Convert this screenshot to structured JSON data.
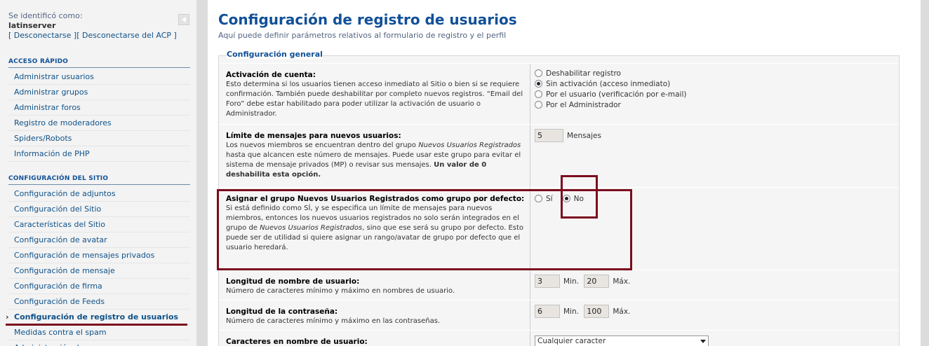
{
  "sidebar": {
    "identified_as": "Se identificó como:",
    "username": "latinserver",
    "links_prefix": "[ ",
    "logout": "Desconectarse",
    "links_mid": " ][ ",
    "logout_acp": "Desconectarse del ACP",
    "links_suffix": " ]",
    "quick_access": {
      "title": "ACCESO RÁPIDO",
      "items": [
        "Administrar usuarios",
        "Administrar grupos",
        "Administrar foros",
        "Registro de moderadores",
        "Spiders/Robots",
        "Información de PHP"
      ]
    },
    "site_config": {
      "title": "CONFIGURACIÓN DEL SITIO",
      "items": [
        "Configuración de adjuntos",
        "Configuración del Sitio",
        "Características del Sitio",
        "Configuración de avatar",
        "Configuración de mensajes privados",
        "Configuración de mensaje",
        "Configuración de firma",
        "Configuración de Feeds",
        "Configuración de registro de usuarios",
        "Medidas contra el spam",
        "Administración de ..."
      ],
      "active_index": 8
    }
  },
  "main": {
    "title": "Configuración de registro de usuarios",
    "subtitle": "Aquí puede definir parámetros relativos al formulario de registro y el perfil",
    "legend": "Configuración general",
    "account_activation": {
      "label": "Activación de cuenta:",
      "desc": "Esto determina si los usuarios tienen acceso inmediato al Sitio o bien si se requiere confirmación. También puede deshabilitar por completo nuevos registros. “Email del Foro” debe estar habilitado para poder utilizar la activación de usuario o Administrador.",
      "options": [
        {
          "label": "Deshabilitar registro",
          "checked": false
        },
        {
          "label": "Sin activación (acceso inmediato)",
          "checked": true
        },
        {
          "label": "Por el usuario (verificación por e-mail)",
          "checked": false
        },
        {
          "label": "Por el Administrador",
          "checked": false
        }
      ]
    },
    "new_member_post_limit": {
      "label": "Límite de mensajes para nuevos usuarios:",
      "desc_1": "Los nuevos miembros se encuentran dentro del grupo ",
      "desc_em": "Nuevos Usuarios Registrados",
      "desc_2": " hasta que alcancen este número de mensajes. Puede usar este grupo para evitar el sistema de mensaje privados (MP) o revisar sus mensajes. ",
      "desc_bold": "Un valor de 0 deshabilita esta opción.",
      "value": "5",
      "unit": "Mensajes"
    },
    "new_member_group_default": {
      "label": "Asignar el grupo Nuevos Usuarios Registrados como grupo por defecto:",
      "desc_1": "Si está definido como SÍ, y se especifica un límite de mensajes para nuevos miembros, entonces los nuevos usuarios registrados no solo serán integrados en el grupo de ",
      "desc_em": "Nuevos Usuarios Registrados",
      "desc_2": ", sino que ese será su grupo por defecto. Esto puede ser de utilidad si quiere asignar un rango/avatar de grupo por defecto que el usuario heredará.",
      "yes": "Sí",
      "no": "No",
      "selected": "No"
    },
    "username_length": {
      "label": "Longitud de nombre de usuario:",
      "desc": "Número de caracteres mínimo y máximo en nombres de usuario.",
      "min": "3",
      "min_label": "Min.",
      "max": "20",
      "max_label": "Máx."
    },
    "password_length": {
      "label": "Longitud de la contraseña:",
      "desc": "Número de caracteres mínimo y máximo en las contraseñas.",
      "min": "6",
      "min_label": "Min.",
      "max": "100",
      "max_label": "Máx."
    },
    "username_chars": {
      "label": "Caracteres en nombre de usuario:",
      "value": "Cualquier caracter"
    }
  },
  "colors": {
    "accent": "#115098",
    "link": "#105289",
    "highlight": "#7b0c1e"
  }
}
